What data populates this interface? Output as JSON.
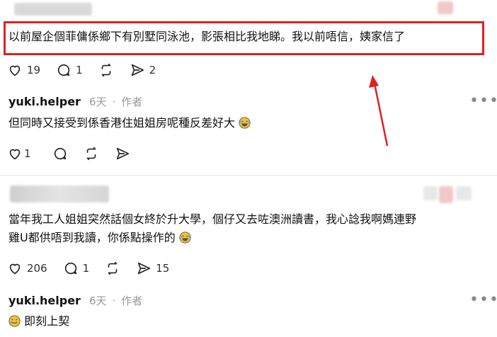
{
  "comments": [
    {
      "text": "以前屋企個菲傭係鄉下有別墅同泳池，影張相比我地睇。我以前唔信，姨家信了",
      "likes": "19",
      "replies": "1",
      "shares": "2"
    },
    {
      "author": "yuki.helper",
      "time": "6天",
      "badge": "作者",
      "text": "但同時又接受到係香港住姐姐房呢種反差好大",
      "likes": "1"
    },
    {
      "text_line1": "當年我工人姐姐突然話個女終於升大學，個仔又去咗澳洲讀書，我心諗我啊媽連野",
      "text_line2": "雞U都供唔到我讀，你係點操作的",
      "likes": "206",
      "replies": "1",
      "shares": "15"
    },
    {
      "author": "yuki.helper",
      "time": "6天",
      "badge": "作者",
      "text": "即刻上契"
    }
  ],
  "annotation": {
    "box_color": "#e02020",
    "arrow_color": "#e02020"
  },
  "icons": [
    "heart-icon",
    "comment-icon",
    "repost-icon",
    "share-icon",
    "more-icon",
    "laughing-emoji",
    "pleading-emoji"
  ]
}
